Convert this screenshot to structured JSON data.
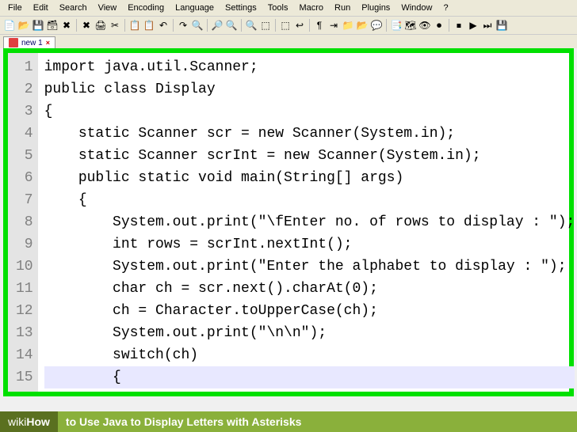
{
  "menu": [
    "File",
    "Edit",
    "Search",
    "View",
    "Encoding",
    "Language",
    "Settings",
    "Tools",
    "Macro",
    "Run",
    "Plugins",
    "Window",
    "?"
  ],
  "toolbar_icons": [
    "new-file-icon",
    "open-file-icon",
    "save-icon",
    "save-all-icon",
    "close-icon",
    "close-all-icon",
    "print-icon",
    "cut-icon",
    "copy-icon",
    "paste-icon",
    "undo-icon",
    "redo-icon",
    "find-icon",
    "replace-icon",
    "zoom-in-icon",
    "zoom-out-icon",
    "sync-v-icon",
    "sync-h-icon",
    "wrap-icon",
    "all-chars-icon",
    "indent-icon",
    "fold-icon",
    "unfold-icon",
    "comment-icon",
    "func-list-icon",
    "doc-map-icon",
    "show-symbol-icon",
    "record-macro-icon",
    "stop-macro-icon",
    "play-macro-icon",
    "play-multi-icon",
    "save-macro-icon"
  ],
  "toolbar_glyphs": [
    "📄",
    "📂",
    "💾",
    "🗃",
    "✖",
    "✖",
    "🖨",
    "✂",
    "📋",
    "📋",
    "↶",
    "↷",
    "🔍",
    "🔎",
    "🔍",
    "🔍",
    "⬚",
    "⬚",
    "↩",
    "¶",
    "⇥",
    "📁",
    "📂",
    "💬",
    "📑",
    "🗺",
    "👁",
    "⏺",
    "⏹",
    "▶",
    "⏭",
    "💾"
  ],
  "tab": {
    "name": "new 1",
    "close": "×"
  },
  "code": {
    "lines": [
      "import java.util.Scanner;",
      "public class Display",
      "{",
      "    static Scanner scr = new Scanner(System.in);",
      "    static Scanner scrInt = new Scanner(System.in);",
      "    public static void main(String[] args)",
      "    {",
      "        System.out.print(\"\\fEnter no. of rows to display : \");",
      "        int rows = scrInt.nextInt();",
      "        System.out.print(\"Enter the alphabet to display : \");",
      "        char ch = scr.next().charAt(0);",
      "        ch = Character.toUpperCase(ch);",
      "        System.out.print(\"\\n\\n\");",
      "        switch(ch)",
      "        {"
    ]
  },
  "footer": {
    "brand_pre": "wiki",
    "brand_bold": "How",
    "title": "to Use Java to Display Letters with Asterisks"
  }
}
